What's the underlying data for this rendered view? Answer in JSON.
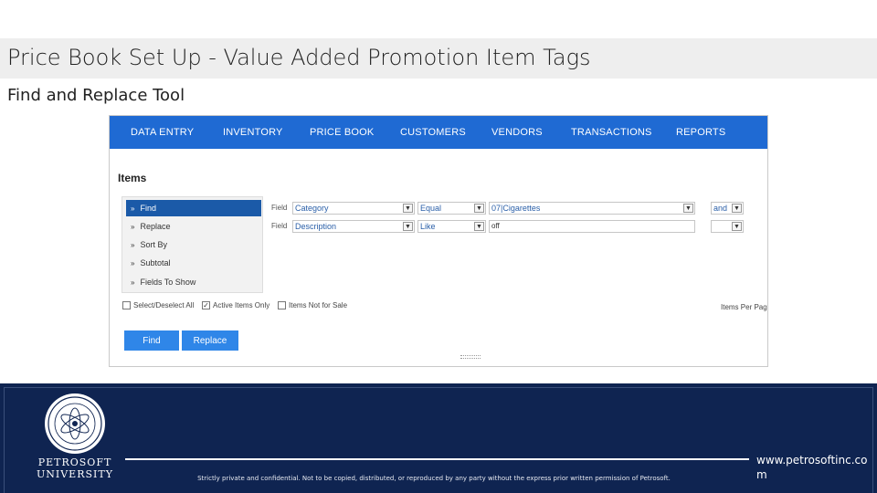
{
  "slide": {
    "title": "Price Book Set Up - Value Added Promotion Item Tags",
    "subtitle": "Find and Replace Tool"
  },
  "app": {
    "nav": [
      "DATA ENTRY",
      "INVENTORY",
      "PRICE BOOK",
      "CUSTOMERS",
      "VENDORS",
      "TRANSACTIONS",
      "REPORTS"
    ],
    "section_title": "Items",
    "sidebar": [
      {
        "label": "Find",
        "active": true
      },
      {
        "label": "Replace",
        "active": false
      },
      {
        "label": "Sort By",
        "active": false
      },
      {
        "label": "Subtotal",
        "active": false
      },
      {
        "label": "Fields To Show",
        "active": false
      }
    ],
    "row1": {
      "field_label": "Field",
      "field": "Category",
      "operator": "Equal",
      "value": "07|Cigarettes",
      "join": "and"
    },
    "row2": {
      "field_label": "Field",
      "field": "Description",
      "operator": "Like",
      "value": "off",
      "join": ""
    },
    "checkboxes": {
      "select_all": {
        "label": "Select/Deselect All",
        "checked": false
      },
      "active_only": {
        "label": "Active Items Only",
        "checked": true
      },
      "not_for_sale": {
        "label": "Items Not for Sale",
        "checked": false
      }
    },
    "items_per_page": "Items Per Pag",
    "buttons": {
      "find": "Find",
      "replace": "Replace"
    },
    "colors": {
      "nav": "#1f6ad3",
      "active_item": "#1b5aa8",
      "button": "#2f86e8"
    }
  },
  "footer": {
    "university": "PETROSOFT UNIVERSITY",
    "disclaimer": "Strictly private and confidential. Not to be copied, distributed, or reproduced by any party without the express prior written permission of Petrosoft.",
    "website": "www.petrosoftinc.com",
    "bg_color": "#0f2451"
  }
}
